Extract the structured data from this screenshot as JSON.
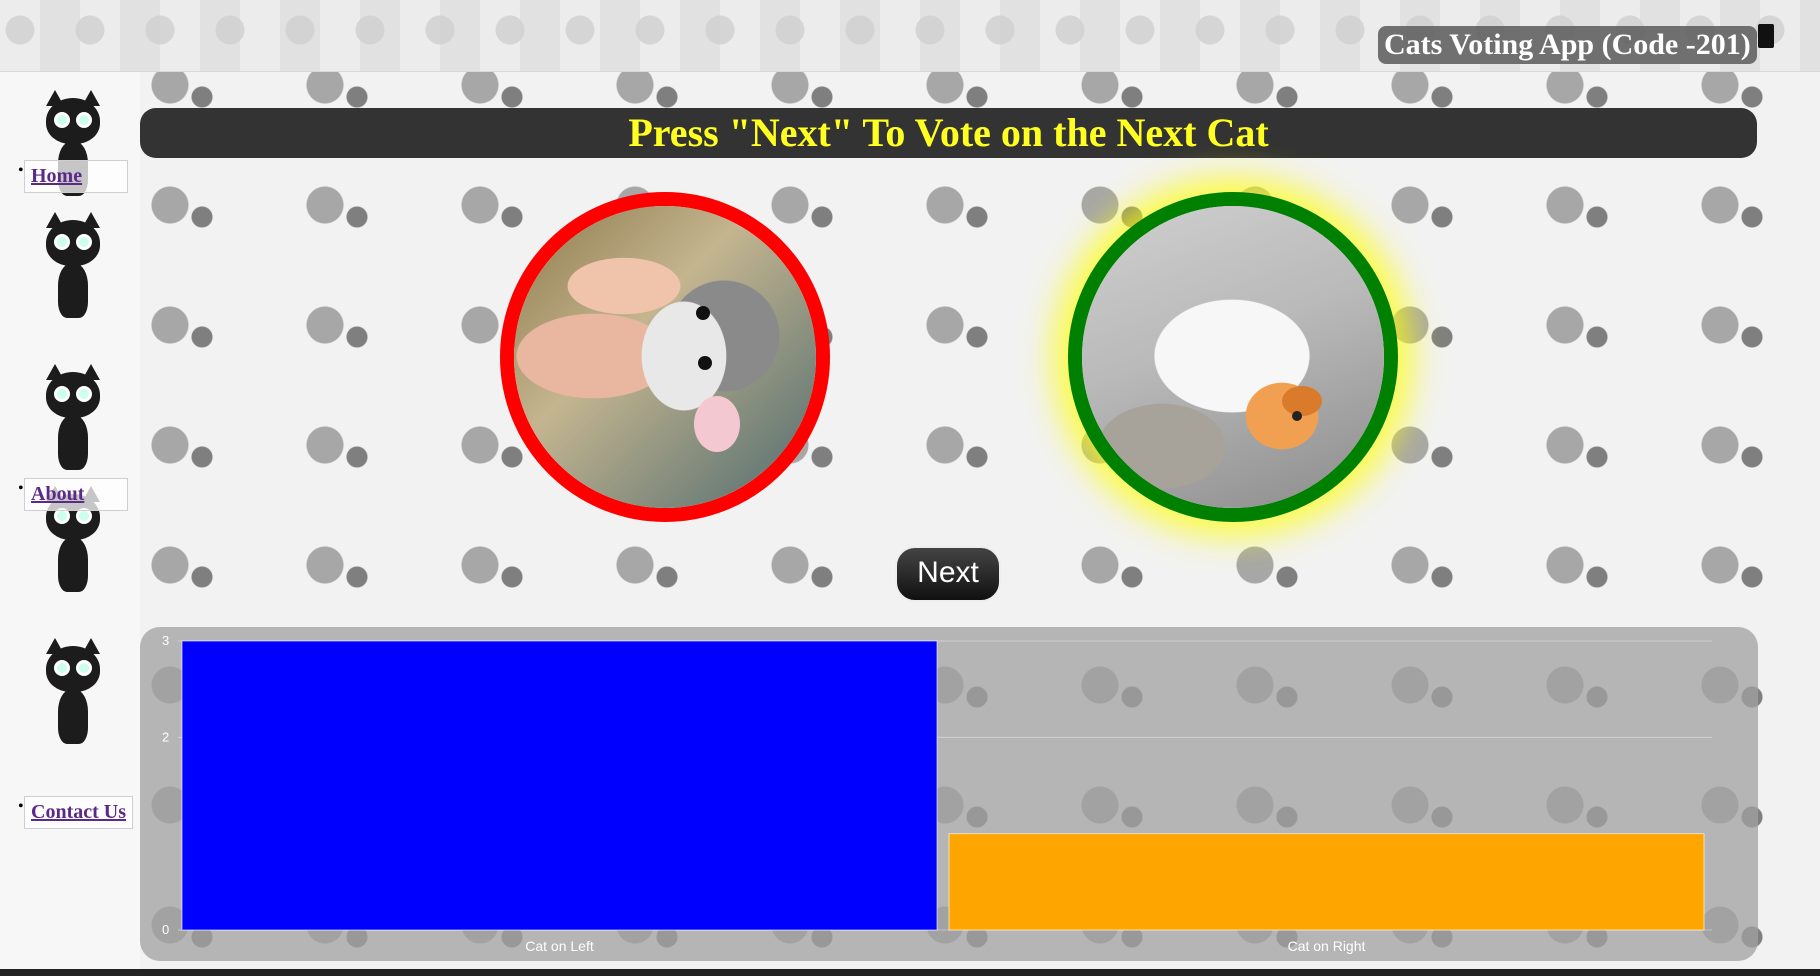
{
  "header": {
    "title": "Cats Voting App (Code -201)",
    "icon": "door-icon"
  },
  "sidebar": {
    "items": [
      {
        "label": "Home"
      },
      {
        "label": "About"
      },
      {
        "label": "Contact Us"
      }
    ]
  },
  "main": {
    "prompt": "Press \"Next\" To Vote on the Next Cat",
    "left_cat": {
      "border_color": "#ff0000"
    },
    "right_cat": {
      "border_color": "#008000",
      "highlight_color": "#ffff00"
    },
    "next_label": "Next"
  },
  "chart_data": {
    "type": "bar",
    "categories": [
      "Cat on Left",
      "Cat on Right"
    ],
    "values": [
      3,
      1
    ],
    "colors": [
      "#0000ff",
      "#ffa500"
    ],
    "yticks": [
      0,
      2,
      3
    ],
    "ylim": [
      0,
      3
    ],
    "grid": true
  }
}
